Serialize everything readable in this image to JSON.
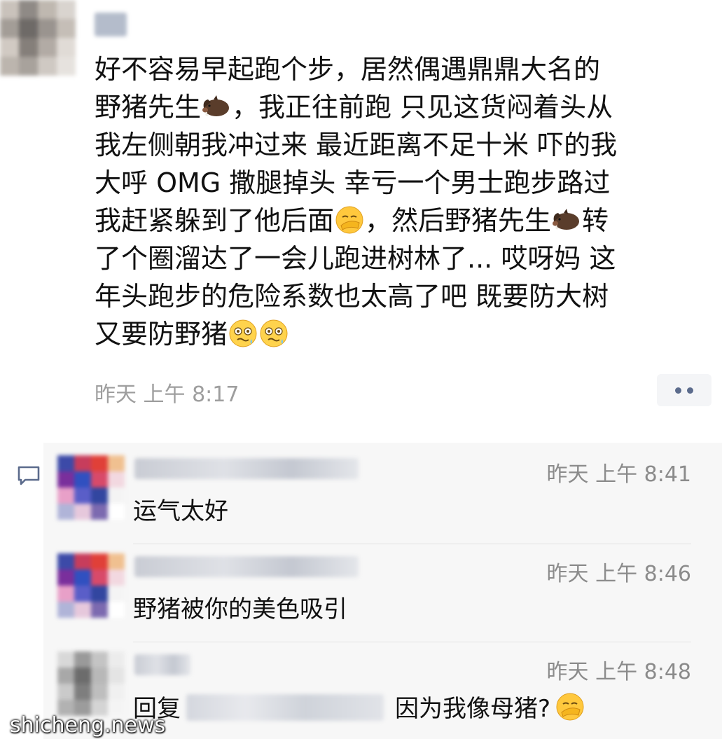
{
  "post": {
    "lines": [
      [
        "好不容易早起跑个步，居然偶遇鼎鼎大名的"
      ],
      [
        "野猪先生",
        "{boar}",
        "，我正往前跑 只见这货闷着头从"
      ],
      [
        "我左侧朝我冲过来 最近距离不足十米 吓的我"
      ],
      [
        "大呼 OMG 撒腿掉头 幸亏一个男士跑步路过"
      ],
      [
        "我赶紧躲到了他后面",
        "{facepalm}",
        "，然后野猪先生",
        "{boar}",
        "转"
      ],
      [
        "了个圈溜达了一会儿跑进树林了... 哎呀妈 这"
      ],
      [
        "年头跑步的危险系数也太高了吧 既要防大树"
      ],
      [
        "又要防野猪",
        "{woozy}",
        "{woozy}"
      ]
    ],
    "time": "昨天 上午 8:17",
    "emoji_icons": {
      "boar": "boar-emoji-icon",
      "facepalm": "facepalm-emoji-icon",
      "woozy": "woozy-face-emoji-icon"
    }
  },
  "comments": [
    {
      "time": "昨天 上午 8:41",
      "text": "运气太好"
    },
    {
      "time": "昨天 上午 8:46",
      "text": "野猪被你的美色吸引"
    },
    {
      "time": "昨天 上午 8:48",
      "reply_prefix": "回复",
      "text": "因为我像母猪?",
      "emoji": "facepalm-emoji-icon"
    }
  ],
  "watermark": "shicheng.news",
  "colors": {
    "time_gray": "#9e9e9e",
    "panel_bg": "#f7f7f7",
    "link_blue": "#5b6b8c"
  }
}
